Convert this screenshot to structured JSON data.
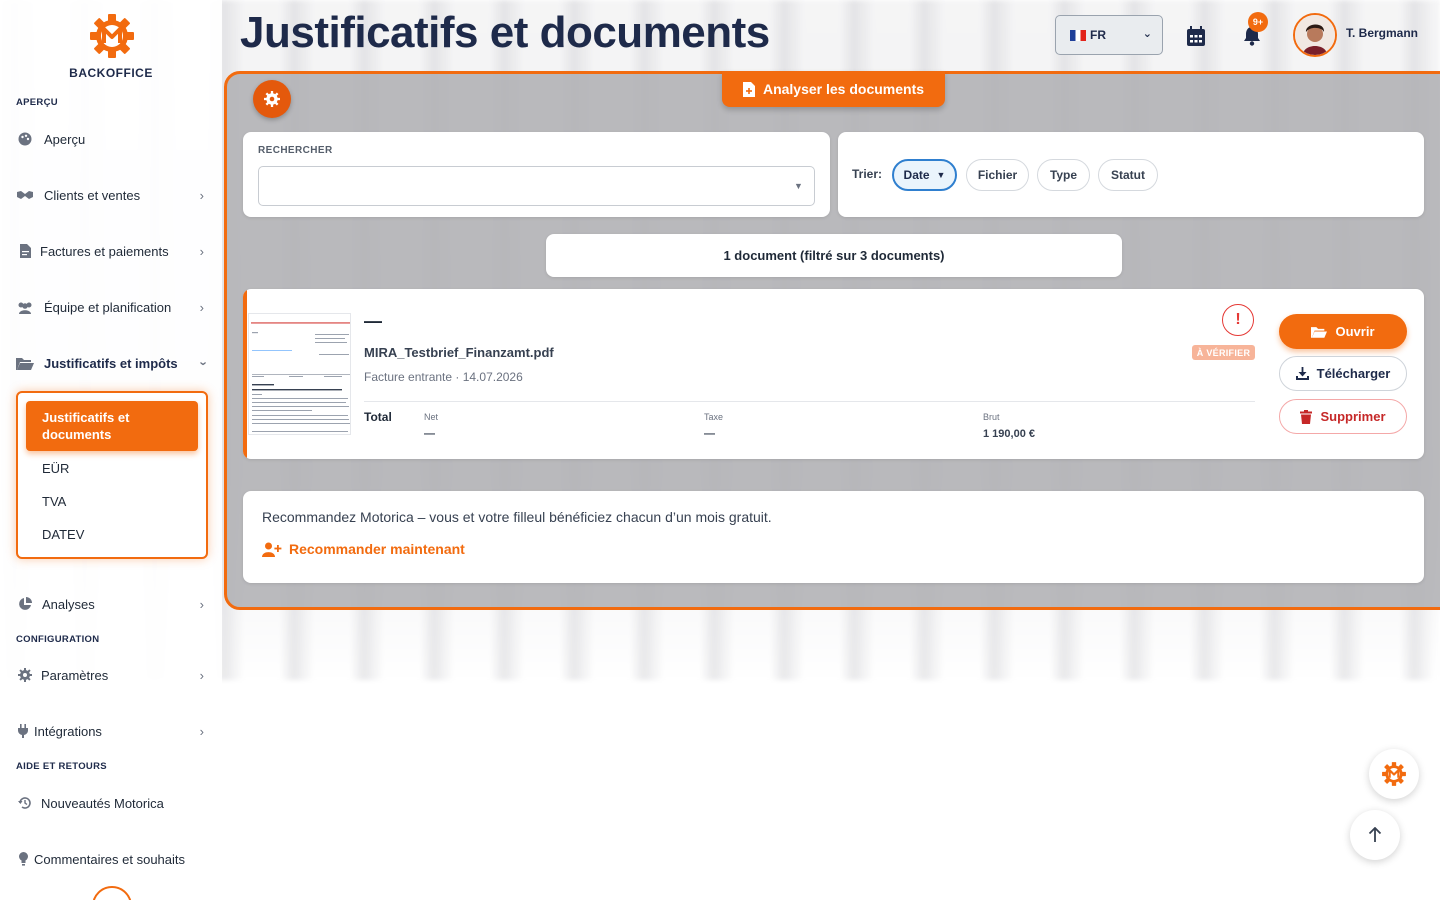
{
  "brand": {
    "name": "BACKOFFICE",
    "accent": "#f26b0f",
    "navy": "#1e2a4a"
  },
  "sidebar": {
    "sections": {
      "apercu": "APERÇU",
      "configuration": "CONFIGURATION",
      "aide": "AIDE ET RETOURS"
    },
    "items": [
      {
        "label": "Aperçu",
        "icon": "palette-icon"
      },
      {
        "label": "Clients et ventes",
        "icon": "handshake-icon"
      },
      {
        "label": "Factures et paiements",
        "icon": "invoice-icon"
      },
      {
        "label": "Équipe et planification",
        "icon": "users-icon"
      },
      {
        "label": "Justificatifs et impôts",
        "icon": "folder-open-icon"
      },
      {
        "label": "Analyses",
        "icon": "pie-chart-icon"
      },
      {
        "label": "Paramètres",
        "icon": "gear-icon"
      },
      {
        "label": "Intégrations",
        "icon": "plug-icon"
      },
      {
        "label": "Nouveautés Motorica",
        "icon": "history-icon"
      },
      {
        "label": "Commentaires et souhaits",
        "icon": "lightbulb-icon"
      }
    ],
    "submenu": [
      "Justificatifs et documents",
      "EÜR",
      "TVA",
      "DATEV"
    ]
  },
  "header": {
    "title": "Justificatifs et documents",
    "language": "FR",
    "notifications_badge": "9+",
    "user_name": "T. Bergmann"
  },
  "toolbar": {
    "analyze_label": "Analyser les documents"
  },
  "search": {
    "label": "RECHERCHER",
    "value": ""
  },
  "sort": {
    "label": "Trier:",
    "options": [
      "Date",
      "Fichier",
      "Type",
      "Statut"
    ],
    "active": "Date",
    "active_arrow": "▼"
  },
  "count_text": "1 document (filtré sur 3 documents)",
  "document": {
    "title": "—",
    "filename": "MIRA_Testbrief_Finanzamt.pdf",
    "subtitle": "Facture entrante · 14.07.2026",
    "status": "À VÉRIFIER",
    "alert": "!",
    "total_label": "Total",
    "net_label": "Net",
    "net_value": "—",
    "tax_label": "Taxe",
    "tax_value": "—",
    "gross_label": "Brut",
    "gross_value": "1 190,00 €",
    "actions": {
      "open": "Ouvrir",
      "download": "Télécharger",
      "delete": "Supprimer"
    }
  },
  "referral": {
    "text": "Recommandez Motorica – vous et votre filleul bénéficiez chacun d’un mois gratuit.",
    "link": "Recommander maintenant"
  },
  "scroll_up_icon": "arrow-up-icon"
}
